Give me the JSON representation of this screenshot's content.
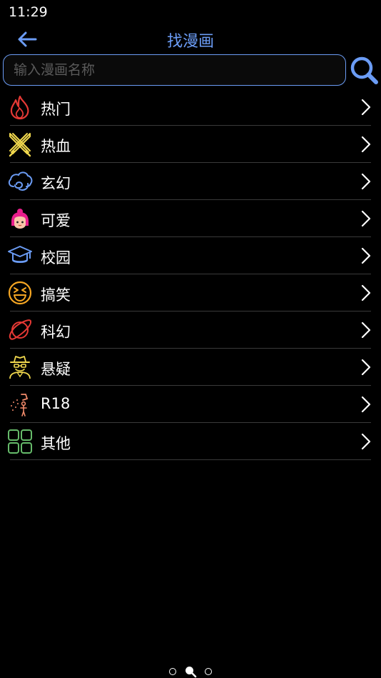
{
  "status_bar": {
    "time": "11:29"
  },
  "header": {
    "title": "找漫画",
    "back_icon": "arrow-left-icon"
  },
  "search": {
    "placeholder": "输入漫画名称",
    "value": "",
    "icon": "search-icon"
  },
  "categories": [
    {
      "label": "热门",
      "icon": "flame-icon",
      "color": "#e53935"
    },
    {
      "label": "热血",
      "icon": "crossed-swords-icon",
      "color": "#f2d94e"
    },
    {
      "label": "玄幻",
      "icon": "cloud-swirl-icon",
      "color": "#6b9cf5"
    },
    {
      "label": "可爱",
      "icon": "cute-girl-icon",
      "color": "#e91e8c"
    },
    {
      "label": "校园",
      "icon": "graduation-cap-icon",
      "color": "#6b9cf5"
    },
    {
      "label": "搞笑",
      "icon": "laughing-face-icon",
      "color": "#f5a623"
    },
    {
      "label": "科幻",
      "icon": "planet-icon",
      "color": "#e53935"
    },
    {
      "label": "悬疑",
      "icon": "detective-icon",
      "color": "#f2d94e"
    },
    {
      "label": "R18",
      "icon": "shower-icon",
      "color": "#f28b6b"
    },
    {
      "label": "其他",
      "icon": "grid-icon",
      "color": "#66bb6a"
    }
  ],
  "page_indicator": {
    "count": 3,
    "active_index": 1
  },
  "colors": {
    "accent": "#6b9cf5",
    "background": "#000000",
    "divider": "#3a3a3a"
  }
}
